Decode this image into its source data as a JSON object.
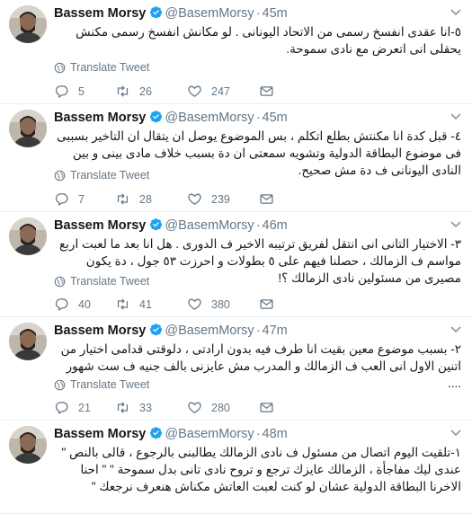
{
  "author": {
    "name": "Bassem Morsy",
    "handle": "@BasemMorsy"
  },
  "translate_label": "Translate Tweet",
  "tweets": [
    {
      "time": "45m",
      "text": "٥-انا عقدى انفسخ رسمى من الاتحاد اليونانى . لو مكانش انفسخ رسمى مكنش يحقلى انى اتعرض مع نادى سموحة.",
      "replies": "5",
      "retweets": "26",
      "likes": "247"
    },
    {
      "time": "45m",
      "text": "٤- قبل كدة انا مكنتش بطلع اتكلم ، بس الموضوع يوصل ان يتقال ان التاخير بسببى فى موضوع البطاقة الدولية وتشويه سمعتى ان دة بسبب خلاف مادى بينى و بين النادى اليونانى ف دة مش صحيح.",
      "replies": "7",
      "retweets": "28",
      "likes": "239"
    },
    {
      "time": "46m",
      "text": "٣- الاختيار التانى انى انتقل لفريق ترتيبه الاخير ف الدورى . هل انا بعد ما لعبت اربع مواسم ف الزمالك ، حصلنا فيهم على ٥ بطولات و احرزت ٥٣ جول ، دة يكون مصيرى من مسئولين نادى الزمالك ؟!",
      "replies": "40",
      "retweets": "41",
      "likes": "380"
    },
    {
      "time": "47m",
      "text": "٢- بسبب موضوع معين بقيت انا طرف فيه بدون ارادتى ، دلوقتى قدامى اختيار من اتنين الاول انى العب ف الزمالك و المدرب مش عايزنى بالف جنيه ف ست شهور ....",
      "replies": "21",
      "retweets": "33",
      "likes": "280"
    },
    {
      "time": "48m",
      "text": "١-تلقيت اليوم اتصال من مسئول ف نادى الزمالك يطالبنى بالرجوع ، قالى بالنص \" عندى ليك مفاجأة ، الزمالك عايزك ترجع و تروح نادى تانى بدل سموحة \" \" احنا الاخرنا البطاقة الدولية عشان لو كنت لعبت العاتش مكناش هنعرف نرجعك \""
    }
  ]
}
